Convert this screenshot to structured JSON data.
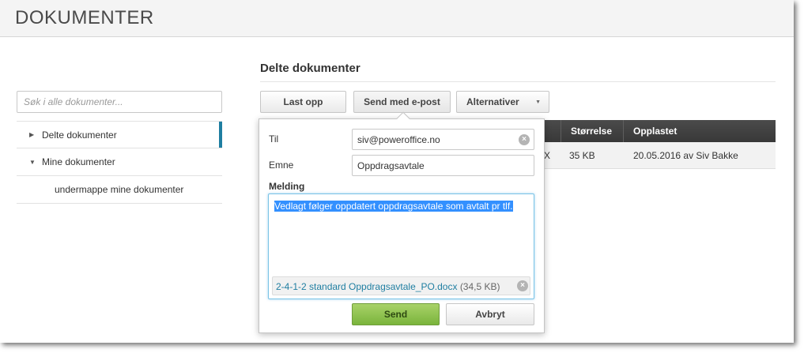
{
  "page": {
    "title": "DOKUMENTER"
  },
  "sidebar": {
    "search_placeholder": "Søk i alle dokumenter...",
    "items": [
      {
        "label": "Delte dokumenter",
        "arrow": "▶",
        "active": true
      },
      {
        "label": "Mine dokumenter",
        "arrow": "▼",
        "active": false
      },
      {
        "label": "undermappe mine dokumenter",
        "arrow": "",
        "active": false
      }
    ]
  },
  "main": {
    "section_title": "Delte dokumenter",
    "toolbar": {
      "upload_label": "Last opp",
      "email_label": "Send med e-post",
      "options_label": "Alternativer"
    },
    "table": {
      "columns": [
        "",
        "Størrelse",
        "Opplastet"
      ],
      "rows": [
        {
          "name_suffix": "X",
          "size": "35 KB",
          "uploaded": "20.05.2016 av Siv Bakke"
        }
      ]
    }
  },
  "email_popup": {
    "to_label": "Til",
    "to_value": "siv@poweroffice.no",
    "subject_label": "Emne",
    "subject_value": "Oppdragsavtale",
    "message_label": "Melding",
    "message_text": "Vedlagt følger oppdatert oppdragsavtale som avtalt pr tlf.",
    "attachment_name": "2-4-1-2 standard Oppdragsavtale_PO.docx",
    "attachment_size": "(34,5 KB)",
    "send_label": "Send",
    "cancel_label": "Avbryt"
  },
  "colors": {
    "accent": "#1f7ea1",
    "send_button": "#8fc44f",
    "table_header": "#3f3f3f",
    "selection": "#3390ff"
  },
  "icons": {
    "clear": "clear-icon",
    "caret": "caret-down-icon"
  }
}
